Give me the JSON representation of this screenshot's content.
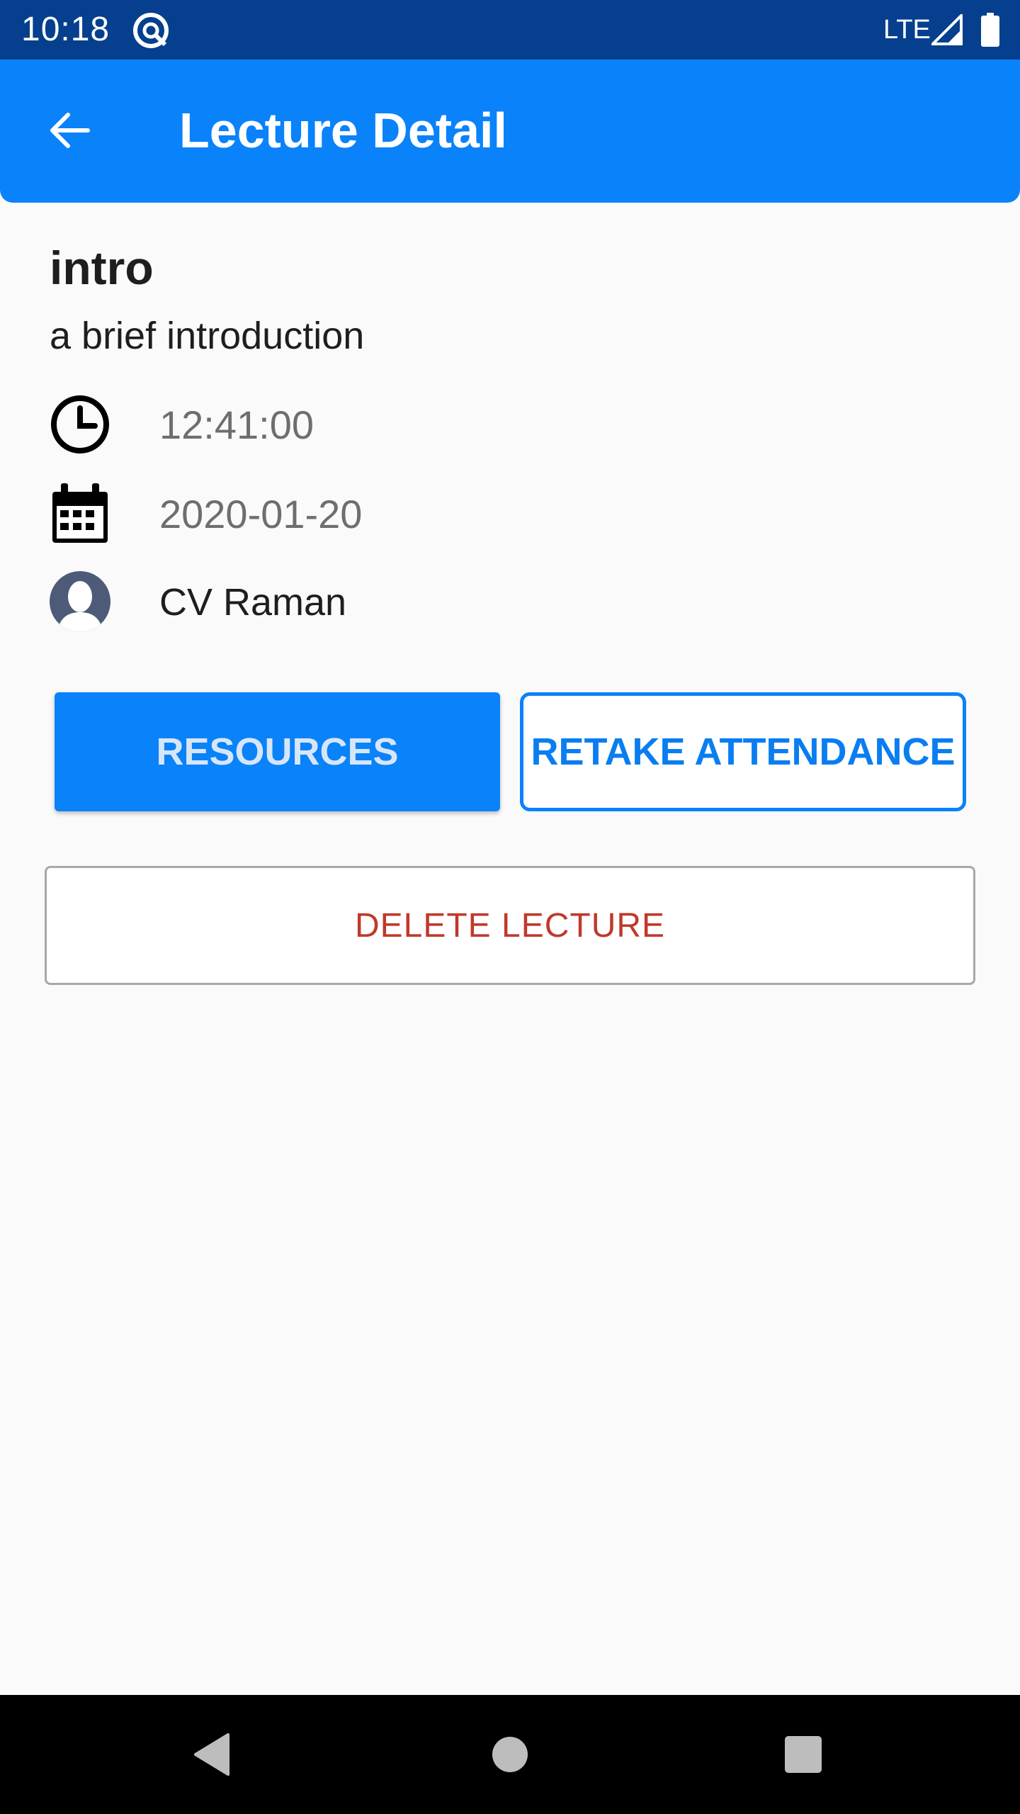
{
  "status_bar": {
    "time": "10:18",
    "network": "LTE"
  },
  "app_bar": {
    "title": "Lecture Detail"
  },
  "lecture": {
    "title": "intro",
    "description": "a brief introduction",
    "time": "12:41:00",
    "date": "2020-01-20",
    "lecturer": "CV Raman"
  },
  "buttons": {
    "resources": "RESOURCES",
    "retake_attendance": "RETAKE ATTENDANCE",
    "delete_lecture": "DELETE LECTURE"
  },
  "icons": {
    "back": "arrow-back-icon",
    "time": "clock-icon",
    "date": "calendar-icon",
    "lecturer": "avatar-icon"
  },
  "colors": {
    "status_bar": "#053f8e",
    "primary": "#0a82fa",
    "delete_text": "#c0392b",
    "background": "#fafafa"
  }
}
